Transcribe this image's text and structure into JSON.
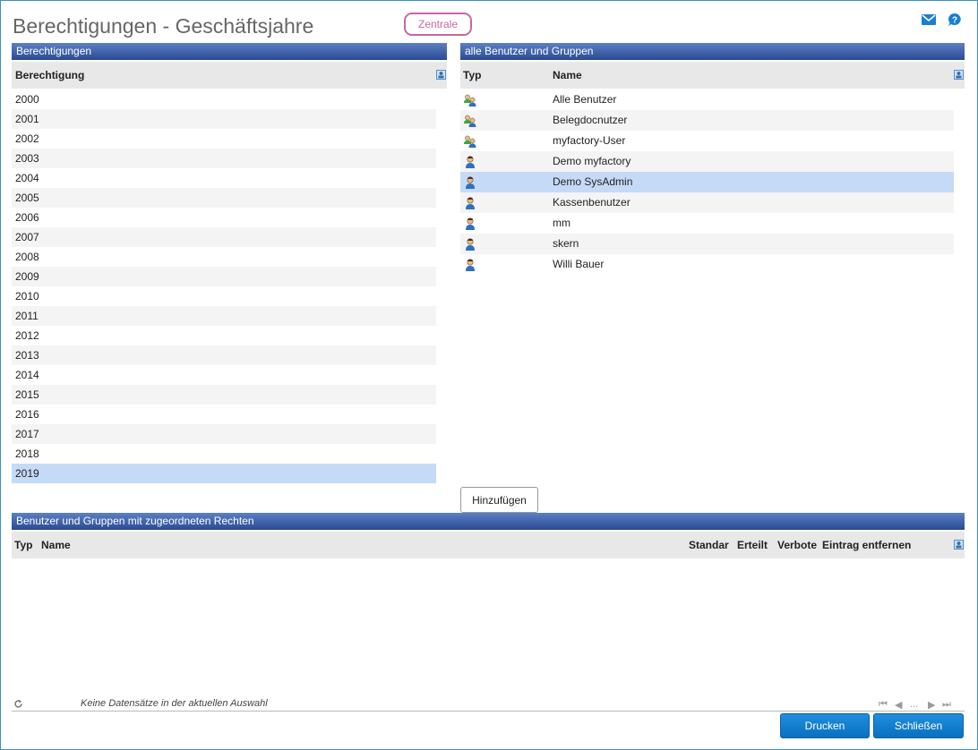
{
  "header": {
    "title": "Berechtigungen - Geschäftsjahre",
    "badge": "Zentrale",
    "icons": [
      "mail-icon",
      "help-icon"
    ]
  },
  "left_panel": {
    "title": "Berechtigungen",
    "column": "Berechtigung",
    "items": [
      "2000",
      "2001",
      "2002",
      "2003",
      "2004",
      "2005",
      "2006",
      "2007",
      "2008",
      "2009",
      "2010",
      "2011",
      "2012",
      "2013",
      "2014",
      "2015",
      "2016",
      "2017",
      "2018",
      "2019"
    ],
    "selected": "2019"
  },
  "right_panel": {
    "title": "alle Benutzer und Gruppen",
    "columns": [
      "Typ",
      "Name"
    ],
    "items": [
      {
        "type": "group",
        "name": "Alle Benutzer"
      },
      {
        "type": "group",
        "name": "Belegdocnutzer"
      },
      {
        "type": "group",
        "name": "myfactory-User"
      },
      {
        "type": "user",
        "name": "Demo myfactory"
      },
      {
        "type": "user",
        "name": "Demo SysAdmin"
      },
      {
        "type": "user",
        "name": "Kassenbenutzer"
      },
      {
        "type": "user",
        "name": "mm"
      },
      {
        "type": "user",
        "name": "skern"
      },
      {
        "type": "user",
        "name": "Willi Bauer"
      }
    ],
    "selected": "Demo SysAdmin"
  },
  "add_button": "Hinzufügen",
  "bottom_panel": {
    "title": "Benutzer und Gruppen mit zugeordneten Rechten",
    "columns": {
      "typ": "Typ",
      "name": "Name",
      "standard": "Standar",
      "erteilt": "Erteilt",
      "verbote": "Verbote",
      "remove": "Eintrag entfernen"
    },
    "status": "Keine Datensätze in der aktuellen Auswahl",
    "pager_text": "..."
  },
  "footer": {
    "print": "Drucken",
    "close": "Schließen"
  },
  "colors": {
    "header_bar": "#3a5aa6",
    "selection": "#c5daf7",
    "badge": "#c9679f",
    "button": "#0a7bd0"
  }
}
